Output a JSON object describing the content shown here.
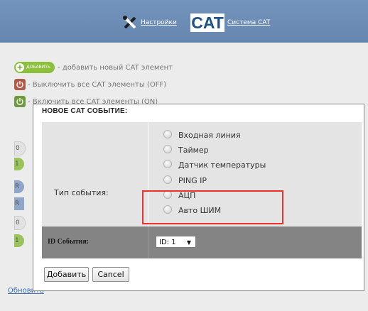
{
  "header": {
    "settings_link": "Настройки",
    "logo_text": "CAT",
    "system_link": "Система CAT"
  },
  "actions": {
    "add_pill": "ДОБАВИТЬ",
    "add_text": "- добавить новый CAT элемент",
    "off_text": "- Выключить все CAT элементы (OFF)",
    "on_text": "- Включить все CAT элементы (ON)"
  },
  "background_items": [
    "0",
    "1",
    "R",
    "R",
    "0",
    "1"
  ],
  "modal": {
    "title": "НОВОЕ CAT СОБЫТИЕ:",
    "event_type_label": "Тип события:",
    "options": [
      "Входная линия",
      "Таймер",
      "Датчик температуры",
      "PING IP",
      "АЦП",
      "Авто ШИМ"
    ],
    "id_label": "ID События:",
    "id_selected": "ID: 1",
    "add_button": "Добавить",
    "cancel_button": "Cancel"
  },
  "footer": {
    "refresh_link": "Обновить"
  },
  "colors": {
    "header_bg": "#6e90b8",
    "add_green": "#8cbf3c",
    "off_red": "#b05a4a",
    "on_green": "#6f9a3f",
    "highlight": "#e8332f"
  }
}
